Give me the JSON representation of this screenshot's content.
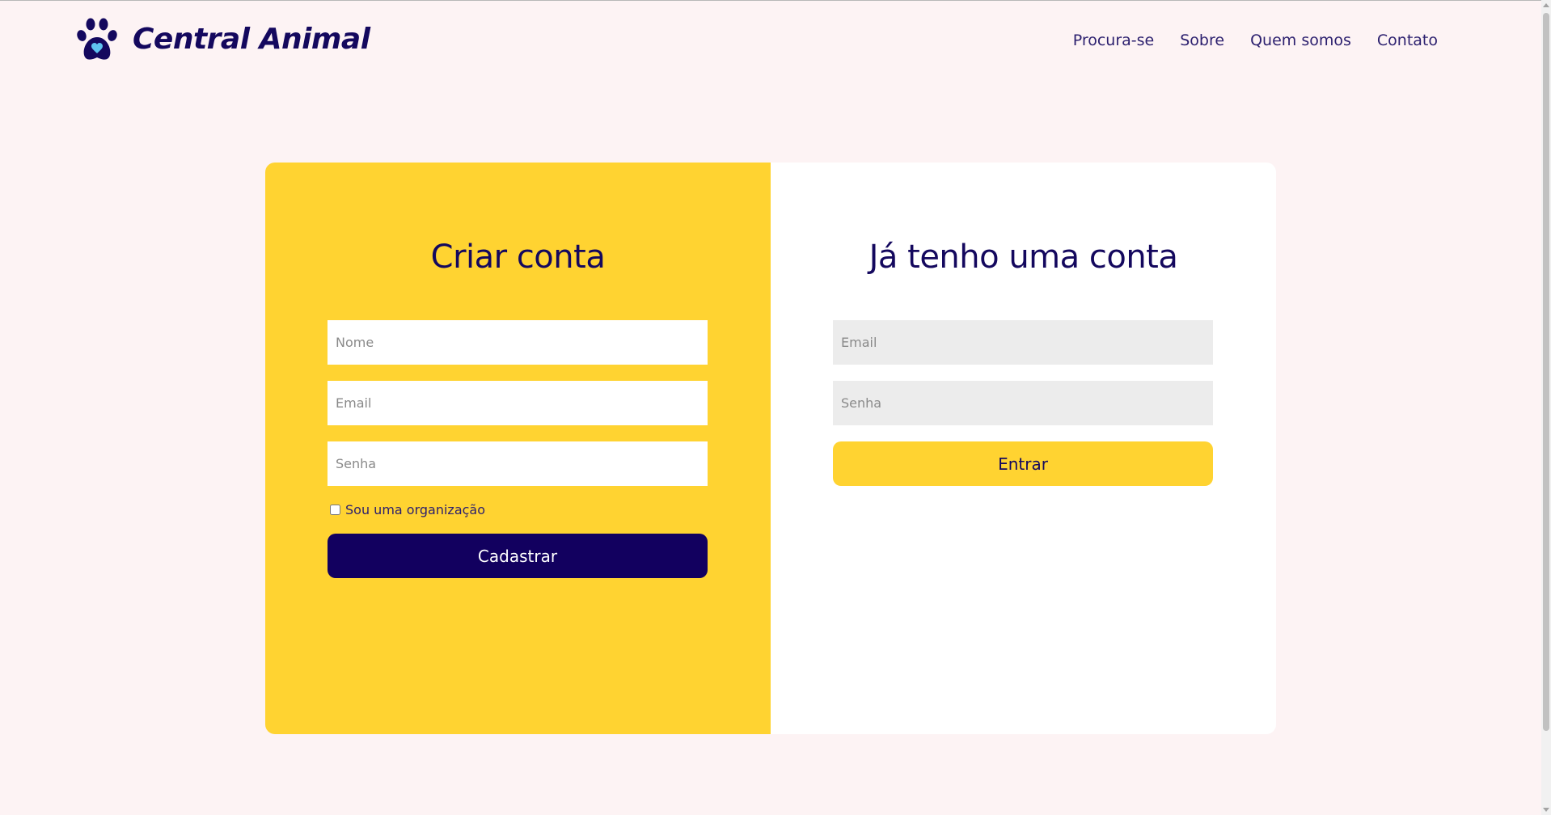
{
  "brand": {
    "name": "Central Animal",
    "logo_icon": "paw-heart-icon",
    "color": "#14085e"
  },
  "nav": {
    "items": [
      {
        "label": "Procura-se"
      },
      {
        "label": "Sobre"
      },
      {
        "label": "Quem somos"
      },
      {
        "label": "Contato"
      }
    ]
  },
  "signup": {
    "title": "Criar conta",
    "name_placeholder": "Nome",
    "email_placeholder": "Email",
    "password_placeholder": "Senha",
    "org_checkbox_label": "Sou uma organização",
    "org_checked": false,
    "submit_label": "Cadastrar"
  },
  "login": {
    "title": "Já tenho uma conta",
    "email_placeholder": "Email",
    "password_placeholder": "Senha",
    "submit_label": "Entrar"
  },
  "colors": {
    "background": "#fdf3f4",
    "accent_yellow": "#ffd331",
    "accent_navy": "#12005f"
  }
}
